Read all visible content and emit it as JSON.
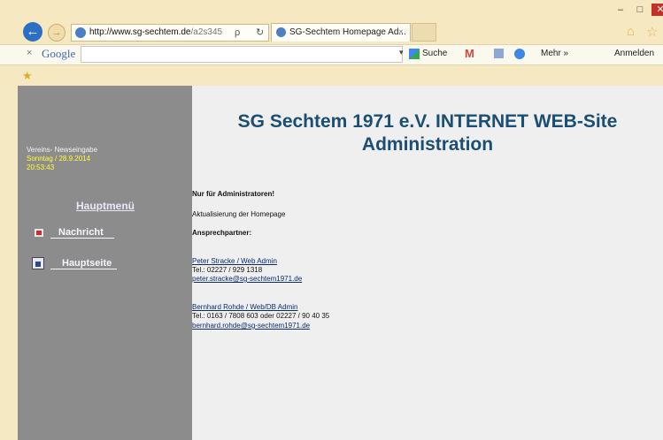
{
  "browser": {
    "url_host": "http://www.sg-sechtem.de",
    "url_path": "/a2s345",
    "search_glyph": "ρ",
    "dropdown_glyph": "▾",
    "refresh_glyph": "↻",
    "tab_title": "SG-Sechtem Homepage Ad...",
    "tab_close": "×",
    "window_min": "–",
    "window_max": "□"
  },
  "toolbar": {
    "close": "×",
    "logo": "Google",
    "suche": "Suche",
    "mehr": "Mehr »",
    "anmelden": "Anmelden"
  },
  "sidebar": {
    "label": "Vereins- Newseingabe",
    "date": "Sonntag / 28.9.2014",
    "time": "20:53:43",
    "menu_title": "Hauptmenü",
    "items": [
      {
        "label": "Nachricht"
      },
      {
        "label": "Hauptseite"
      }
    ]
  },
  "main": {
    "title_line1": "SG Sechtem 1971 e.V. INTERNET WEB-Site",
    "title_line2": "Administration",
    "admins_only": "Nur für Administratoren!",
    "update": "Aktualisierung der Homepage",
    "contact_heading": "Ansprechpartner:",
    "contacts": [
      {
        "name_line": "Peter Stracke / Web Admin",
        "tel": "Tel.: 02227 / 929 1318",
        "email": "peter.stracke@sg-sechtem1971.de"
      },
      {
        "name_line": "Bernhard Rohde / Web/DB Admin",
        "tel": "Tel.: 0163 / 7808 603 oder 02227 / 90 40 35",
        "email": "bernhard.rohde@sg-sechtem1971.de"
      }
    ]
  },
  "colors": {
    "chrome_bg": "#f6e9c2",
    "sidebar_bg": "#8c8c8c",
    "title_color": "#1a4f73",
    "date_color": "#ffff33"
  }
}
